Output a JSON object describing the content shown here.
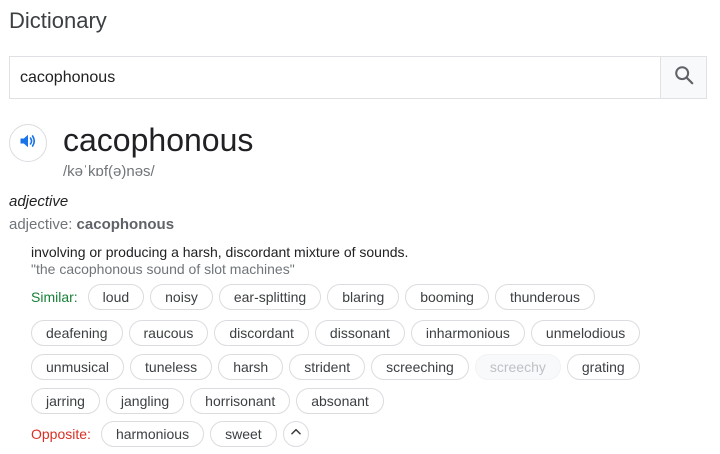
{
  "app": {
    "title": "Dictionary"
  },
  "search": {
    "value": "cacophonous",
    "icon": "search-icon"
  },
  "entry": {
    "word": "cacophonous",
    "phonetic": "/kəˈkɒf(ə)nəs/",
    "pos": "adjective",
    "pos_prefix": "adjective:",
    "pos_word": "cacophonous",
    "definition": "involving or producing a harsh, discordant mixture of sounds.",
    "example": "\"the cacophonous sound of slot machines\""
  },
  "similar": {
    "label": "Similar:",
    "rows": [
      [
        "loud",
        "noisy",
        "ear-splitting",
        "blaring",
        "booming",
        "thunderous"
      ],
      [
        "deafening",
        "raucous",
        "discordant",
        "dissonant",
        "inharmonious",
        "unmelodious"
      ],
      [
        "unmusical",
        "tuneless",
        "harsh",
        "strident",
        "screeching",
        "screechy",
        "grating"
      ],
      [
        "jarring",
        "jangling",
        "horrisonant",
        "absonant"
      ]
    ],
    "disabled": [
      "screechy"
    ]
  },
  "opposite": {
    "label": "Opposite:",
    "items": [
      "harmonious",
      "sweet"
    ]
  },
  "colors": {
    "similar_label": "#188038",
    "opposite_label": "#d93025",
    "speaker_icon": "#1a73e8"
  }
}
